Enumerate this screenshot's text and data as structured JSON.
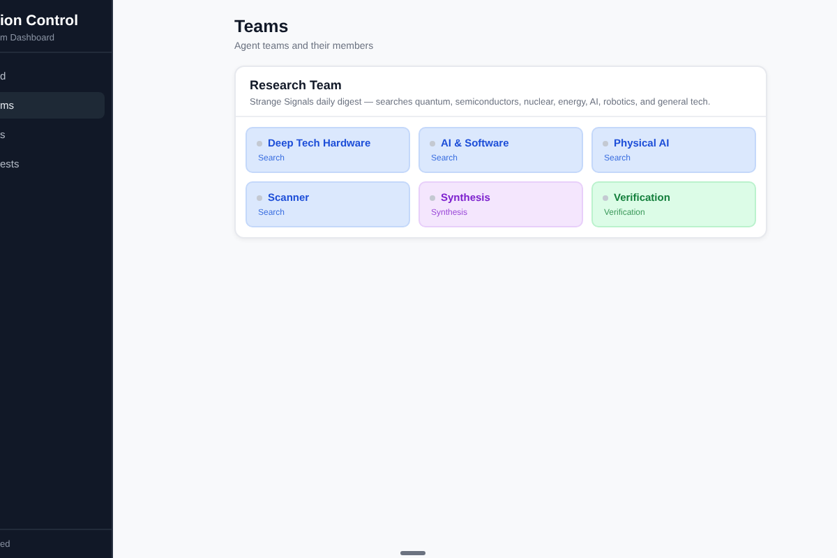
{
  "sidebar": {
    "title": "ion Control",
    "subtitle": "m Dashboard",
    "items": [
      {
        "label": "d",
        "selected": false
      },
      {
        "label": "ms",
        "selected": true
      },
      {
        "label": "s",
        "selected": false
      },
      {
        "label": "ests",
        "selected": false
      }
    ],
    "footer": "ed"
  },
  "page": {
    "title": "Teams",
    "subtitle": "Agent teams and their members"
  },
  "teams": [
    {
      "name": "Research Team",
      "description": "Strange Signals daily digest — searches quantum, semiconductors, nuclear, energy, AI, robotics, and general tech.",
      "members": [
        {
          "name": "Deep Tech Hardware",
          "role": "Search",
          "kind": "search"
        },
        {
          "name": "AI & Software",
          "role": "Search",
          "kind": "search"
        },
        {
          "name": "Physical AI",
          "role": "Search",
          "kind": "search"
        },
        {
          "name": "Scanner",
          "role": "Search",
          "kind": "search"
        },
        {
          "name": "Synthesis",
          "role": "Synthesis",
          "kind": "synthesis"
        },
        {
          "name": "Verification",
          "role": "Verification",
          "kind": "verification"
        }
      ]
    }
  ]
}
